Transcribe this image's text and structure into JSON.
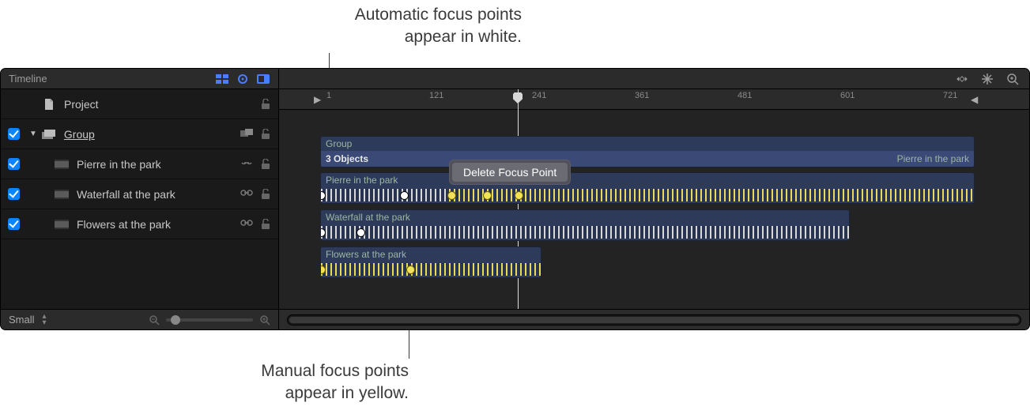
{
  "annotations": {
    "top": "Automatic focus points\nappear in white.",
    "bottom": "Manual focus points\nappear in yellow."
  },
  "header": {
    "title": "Timeline"
  },
  "ruler": {
    "ticks": [
      "1",
      "121",
      "241",
      "361",
      "481",
      "601",
      "721"
    ]
  },
  "sidebar": {
    "items": [
      {
        "label": "Project"
      },
      {
        "label": "Group"
      },
      {
        "label": "Pierre in the park"
      },
      {
        "label": "Waterfall at the park"
      },
      {
        "label": "Flowers at the park"
      }
    ]
  },
  "timeline": {
    "group_label": "Group",
    "objects_label": "3 Objects",
    "right_label": "Pierre in the park",
    "clips": {
      "pierre": "Pierre in the park",
      "waterfall": "Waterfall at the park",
      "flowers": "Flowers at the park"
    },
    "context_menu": "Delete Focus Point"
  },
  "footer": {
    "size_label": "Small"
  }
}
